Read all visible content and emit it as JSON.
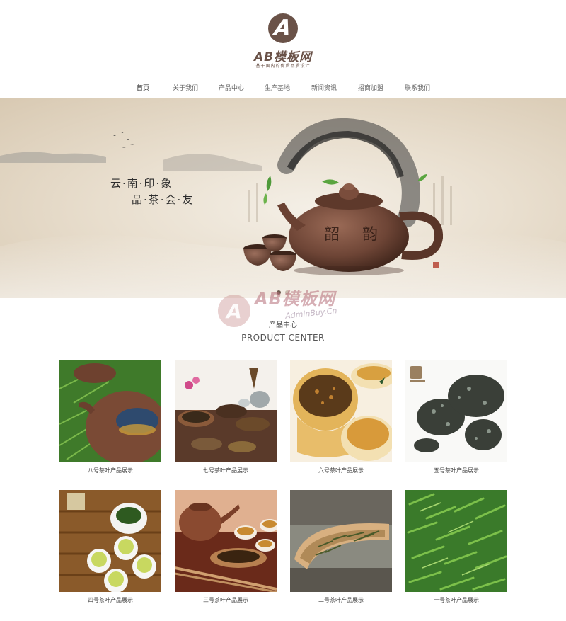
{
  "header": {
    "logo_mark": "A",
    "logo_text": "AB模板网",
    "slogan": "基于国内的优质品质设计"
  },
  "nav": {
    "items": [
      {
        "label": "首页",
        "active": true
      },
      {
        "label": "关于我们",
        "active": false
      },
      {
        "label": "产品中心",
        "active": false
      },
      {
        "label": "生产基地",
        "active": false
      },
      {
        "label": "新闻资讯",
        "active": false
      },
      {
        "label": "招商加盟",
        "active": false
      },
      {
        "label": "联系我们",
        "active": false
      }
    ]
  },
  "banner": {
    "line1": "云·南·印·象",
    "line2": "品·茶·会·友",
    "teapot_characters": [
      "韶",
      "韵"
    ],
    "slide_count": 2,
    "active_slide": 1
  },
  "watermark": {
    "mark": "A",
    "title": "AB模板网",
    "sub": "AdminBuy.Cn"
  },
  "section": {
    "title_cn": "产品中心",
    "title_en": "PRODUCT CENTER"
  },
  "products": [
    {
      "caption": "八号茶叶产品展示"
    },
    {
      "caption": "七号茶叶产品展示"
    },
    {
      "caption": "六号茶叶产品展示"
    },
    {
      "caption": "五号茶叶产品展示"
    },
    {
      "caption": "四号茶叶产品展示"
    },
    {
      "caption": "三号茶叶产品展示"
    },
    {
      "caption": "二号茶叶产品展示"
    },
    {
      "caption": "一号茶叶产品展示"
    }
  ],
  "colors": {
    "brand": "#6a5248",
    "banner_bg": "#e9dfcf",
    "nav_text": "#666666"
  }
}
